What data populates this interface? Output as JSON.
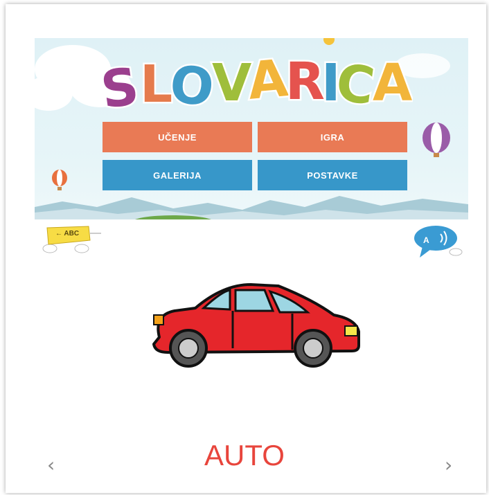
{
  "app": {
    "logo_text": "SLOVARICA"
  },
  "menu": {
    "learn_label": "UČENJE",
    "game_label": "IGRA",
    "gallery_label": "GALERIJA",
    "settings_label": "POSTAVKE"
  },
  "toolbar": {
    "back_label": "ABC",
    "speak_letter": "A"
  },
  "card": {
    "word": "AUTO",
    "image_icon": "car-icon"
  },
  "nav": {
    "prev": "‹",
    "next": "›"
  },
  "colors": {
    "orange_button": "#e97a55",
    "blue_button": "#3797c9",
    "word_red": "#e8453c",
    "car_red": "#e5262b"
  }
}
